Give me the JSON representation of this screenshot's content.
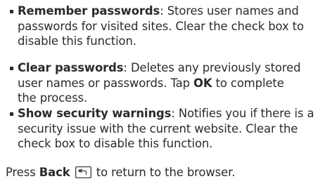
{
  "items": [
    {
      "term": "Remember passwords",
      "sep": ":",
      "line1": " Stores user names and",
      "line2": "passwords for visited sites. Clear the check box to",
      "line3": "disable this function."
    },
    {
      "term": "Clear passwords",
      "sep": ":",
      "line1": " Deletes any previously stored",
      "line2": "user names or passwords. Tap ",
      "line2_bold": "OK",
      "line2_end": " to complete",
      "line3": "the process."
    },
    {
      "term": "Show security warnings",
      "sep": ":",
      "line1": " Notifies you if there is a",
      "line2": "security issue with the current website. Clear the",
      "line3": "check box to disable this function."
    }
  ],
  "footer": {
    "pre": "Press ",
    "key": "Back",
    "icon": "back-icon",
    "post": " to return to the browser."
  }
}
